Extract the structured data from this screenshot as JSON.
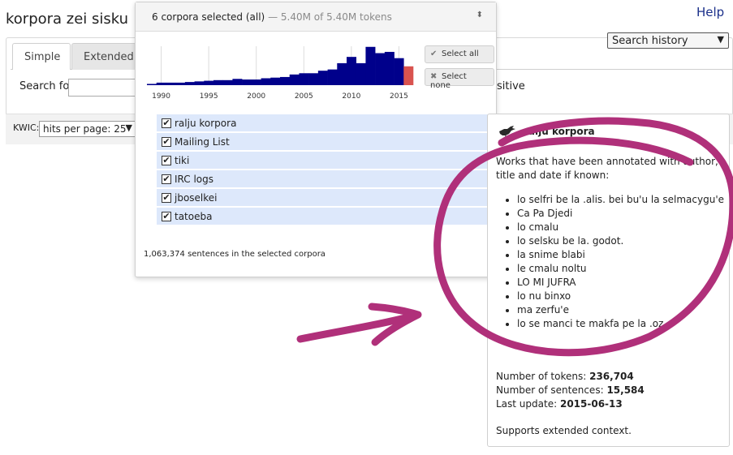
{
  "page": {
    "title": "korpora zei sisku",
    "help": "Help"
  },
  "search_history": {
    "label": "Search history",
    "caret": "▼"
  },
  "tabs": [
    {
      "label": "Simple"
    },
    {
      "label": "Extended"
    }
  ],
  "search": {
    "label": "Search for",
    "value": "",
    "case_text": "sitive"
  },
  "kwic": {
    "label": "KWIC:",
    "hits_per_page": "hits per page: 25",
    "caret": "▼"
  },
  "corpus_popup": {
    "selected_text": "6 corpora selected (all)",
    "token_text": "— 5.40M of 5.40M tokens",
    "updown": "⬍",
    "select_all": "Select all",
    "select_none": "Select none",
    "check_glyph": "✔",
    "cross_glyph": "✖",
    "corpora": [
      {
        "name": "ralju korpora",
        "checked": true
      },
      {
        "name": "Mailing List",
        "checked": true
      },
      {
        "name": "tiki",
        "checked": true
      },
      {
        "name": "IRC logs",
        "checked": true
      },
      {
        "name": "jboselkei",
        "checked": true
      },
      {
        "name": "tatoeba",
        "checked": true
      }
    ],
    "sentence_count": "1,063,374 sentences in the selected corpora",
    "timeline": {
      "year_labels": [
        "1990",
        "1995",
        "2000",
        "2005",
        "2010",
        "2015"
      ],
      "colors": {
        "bar": "#00008b",
        "highlight": "#d9534f"
      }
    }
  },
  "chart_data": {
    "type": "bar",
    "x": [
      1989,
      1990,
      1991,
      1992,
      1993,
      1994,
      1995,
      1996,
      1997,
      1998,
      1999,
      2000,
      2001,
      2002,
      2003,
      2004,
      2005,
      2006,
      2007,
      2008,
      2009,
      2010,
      2011,
      2012,
      2013,
      2014,
      2015,
      2016
    ],
    "values": [
      2,
      4,
      4,
      4,
      5,
      6,
      7,
      8,
      8,
      10,
      9,
      9,
      11,
      12,
      13,
      17,
      19,
      19,
      23,
      25,
      35,
      45,
      35,
      61,
      51,
      53,
      43,
      30
    ],
    "xlim": [
      1989,
      2017
    ],
    "tick_labels": [
      "1990",
      "1995",
      "2000",
      "2005",
      "2010",
      "2015"
    ],
    "highlight_x": 2016,
    "grid": true
  },
  "info": {
    "title": "ralju korpora",
    "description": "Works that have been annotated with author, title and date if known:",
    "works": [
      "lo selfri be la .alis. bei bu'u la selmacygu'e",
      "Ca Pa Djedi",
      "lo cmalu",
      "lo selsku be la. godot.",
      "la snime blabi",
      "le cmalu noltu",
      "LO MI JUFRA",
      "lo nu binxo",
      "ma zerfu'e",
      "lo se manci te makfa pe la .oz."
    ],
    "tokens_label": "Number of tokens:",
    "tokens": "236,704",
    "sentences_label": "Number of sentences:",
    "sentences": "15,584",
    "update_label": "Last update:",
    "update": "2015-06-13",
    "extended": "Supports extended context."
  },
  "annotation": {
    "color": "#b0307a"
  }
}
